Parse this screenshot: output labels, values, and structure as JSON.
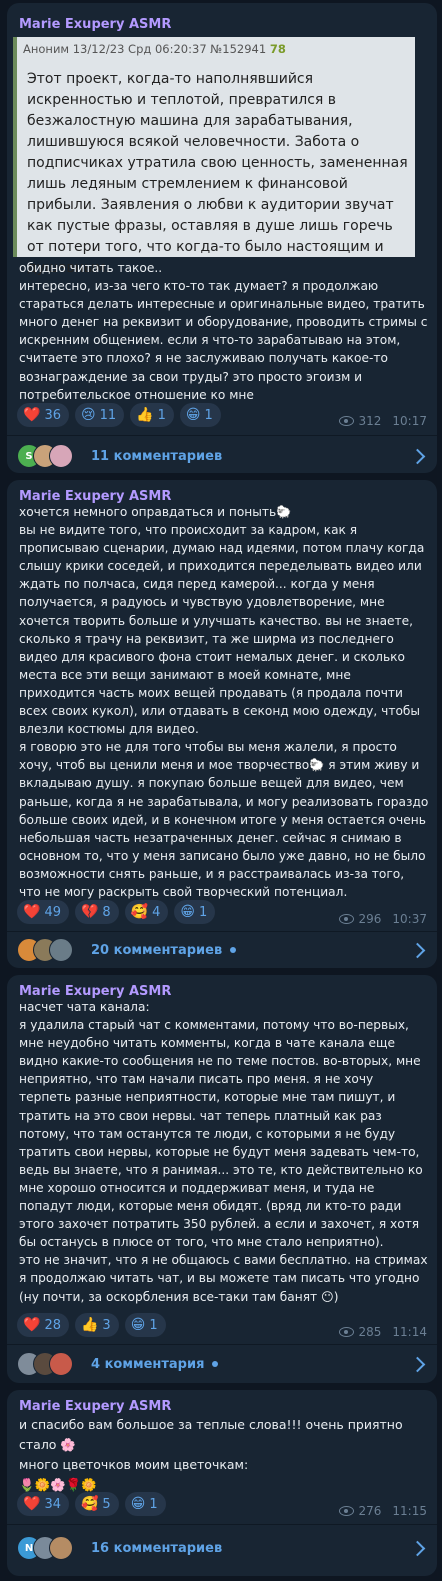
{
  "posts": [
    {
      "author": "Marie Exupery ASMR",
      "quote": {
        "meta": "Аноним  13/12/23 Срд 06:20:37  №152941",
        "num": "78",
        "text": "Этот проект, когда-то наполнявшийся искренностью и теплотой, превратился в безжалостную машина для зарабатывания, лишившуюся всякой человечности. Забота о подписчиках утратила свою ценность, замененная лишь ледяным стремлением к финансовой прибыли. Заявления о любви к аудитории звучат как пустые фразы, оставляя в душе лишь горечь от потери того, что когда-то было настоящим и душевным."
      },
      "body": "обидно читать такое..\nинтересно, из-за чего кто-то так думает? я продолжаю стараться делать интересные и оригинальные видео, тратить много денег на реквизит и оборудование, проводить стримы с искренним общением. если я что-то зарабатываю на этом, считаете это плохо? я не заслуживаю получать какое-то вознаграждение за свои труды? это просто эгоизм и потребительское отношение ко мне",
      "reactions": [
        {
          "emoji": "❤️",
          "count": "36"
        },
        {
          "emoji": "😢",
          "count": "11"
        },
        {
          "emoji": "👍",
          "count": "1"
        },
        {
          "emoji": "😁",
          "count": "1"
        }
      ],
      "views": "312",
      "time": "10:17",
      "comments": "11 комментариев"
    },
    {
      "author": "Marie Exupery ASMR",
      "body": "хочется немного оправдаться и поныть🐑\nвы не видите того, что происходит за кадром, как я прописываю сценарии, думаю над идеями, потом плачу когда слышу крики соседей, и приходится переделывать видео или ждать по полчаса, сидя перед камерой... когда у меня получается, я радуюсь и чувствую удовлетворение, мне хочется творить больше и улучшать качество. вы не знаете, сколько я трачу на реквизит, та же ширма из последнего видео для красивого фона стоит немалых денег. и сколько места все эти вещи занимают в моей комнате, мне приходится часть моих вещей продавать (я продала почти всех своих кукол), или отдавать в секонд мою одежду, чтобы влезли костюмы для видео.\nя говорю это не для того чтобы вы меня жалели, я просто хочу, чтоб вы ценили меня и мое творчество🐑 я этим живу и вкладываю душу. я покупаю больше вещей для видео, чем раньше, когда я не зарабатывала, и могу реализовать гораздо больше своих идей, и в конечном итоге у меня остается очень небольшая часть незатраченных денег. сейчас я снимаю в основном то, что у меня записано было уже давно, но не было возможности снять раньше, и я расстраивалась из-за того, что не могу раскрыть свой творческий потенциал.",
      "reactions": [
        {
          "emoji": "❤️",
          "count": "49"
        },
        {
          "emoji": "💔",
          "count": "8"
        },
        {
          "emoji": "🥰",
          "count": "4"
        },
        {
          "emoji": "😁",
          "count": "1"
        }
      ],
      "views": "296",
      "time": "10:37",
      "comments": "20 комментариев"
    },
    {
      "author": "Marie Exupery ASMR",
      "body": "насчет чата канала:\nя удалила старый чат с комментами, потому что во-первых, мне неудобно читать комменты, когда в чате канала еще видно какие-то сообщения не по теме постов. во-вторых, мне неприятно, что там начали писать про меня. я не хочу терпеть разные неприятности, которые мне там пишут, и тратить на это свои нервы. чат теперь платный как раз потому, что там останутся те люди, с которыми я не буду тратить свои нервы, которые не будут меня задевать чем-то, ведь вы знаете, что я ранимая... это те, кто действительно ко мне хорошо относится и поддерживат меня, и туда не попадут люди, которые меня обидят. (вряд ли кто-то ради этого захочет потратить 350 рублей. а если и захочет, я хотя бы останусь в плюсе от того, что мне стало неприятно).\nэто не значит, что я не общаюсь с вами бесплатно. на стримах я продолжаю читать чат, и вы можете там писать что угодно (ну почти, за оскорбления все-таки там банят 😶)",
      "reactions": [
        {
          "emoji": "❤️",
          "count": "28"
        },
        {
          "emoji": "👍",
          "count": "3"
        },
        {
          "emoji": "😁",
          "count": "1"
        }
      ],
      "views": "285",
      "time": "11:14",
      "comments": "4 комментария"
    },
    {
      "author": "Marie Exupery ASMR",
      "body": "и спасибо вам большое за теплые слова!!! очень приятно стало 🌸\nмного цветочков моим цветочкам:\n🌷🌼🌸🌹🌼",
      "reactions": [
        {
          "emoji": "❤️",
          "count": "34"
        },
        {
          "emoji": "🥰",
          "count": "5"
        },
        {
          "emoji": "😁",
          "count": "1"
        }
      ],
      "views": "276",
      "time": "11:15",
      "comments": "16 комментариев"
    }
  ],
  "colors": {
    "background": "#0e1621",
    "bubble": "#182533",
    "author": "#b39aff",
    "accent": "#5fa3e6",
    "meta": "#6b7f93"
  },
  "icons": [
    "eye-icon",
    "chevron-right-icon",
    "avatar"
  ]
}
